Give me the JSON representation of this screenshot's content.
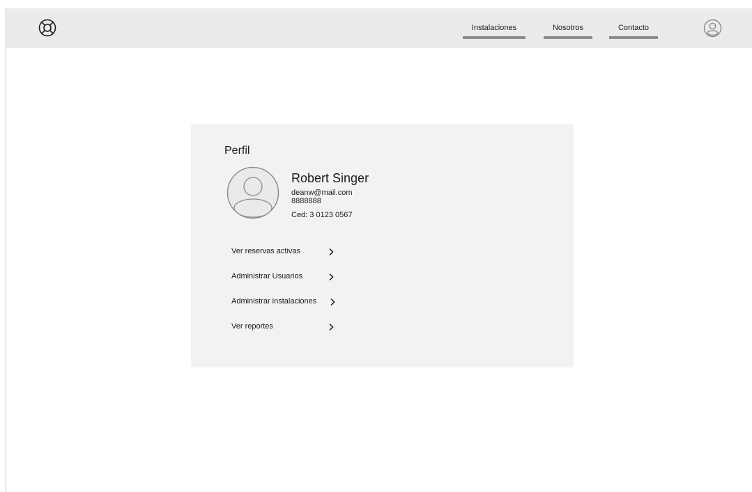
{
  "header": {
    "logo_icon": "lifebuoy-icon",
    "nav": [
      {
        "label": "Instalaciones"
      },
      {
        "label": "Nosotros"
      },
      {
        "label": "Contacto"
      }
    ],
    "user_icon": "user-circle-icon"
  },
  "profile": {
    "title": "Perfil",
    "avatar_icon": "avatar-placeholder-icon",
    "name": "Robert Singer",
    "email": "deanw@mail.com",
    "phone": "8888888",
    "ced": "Ced: 3 0123 0567",
    "menu": [
      {
        "label": "Ver reservas activas",
        "icon": "chevron-right-icon"
      },
      {
        "label": "Administrar Usuarios",
        "icon": "chevron-right-icon"
      },
      {
        "label": "Administrar instalaciones",
        "icon": "chevron-right-icon"
      },
      {
        "label": "Ver reportes",
        "icon": "chevron-right-icon"
      }
    ]
  },
  "colors": {
    "topbar_bg": "#ebebeb",
    "card_bg": "#f2f2f2",
    "nav_underline": "#8c8c8c",
    "icon_stroke": "#8c8c8c"
  }
}
